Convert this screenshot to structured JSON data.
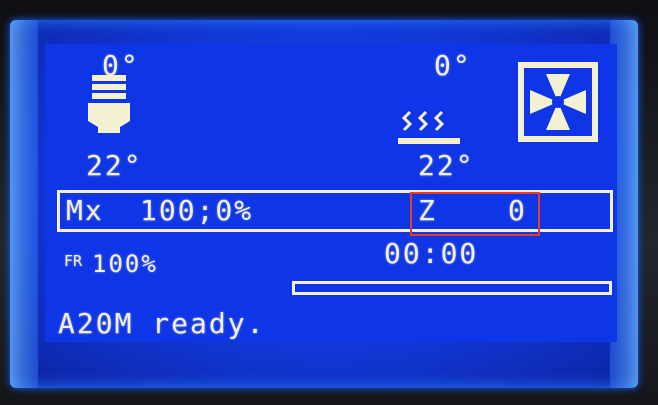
{
  "display": {
    "hotend": {
      "target": "0°",
      "current": "22°"
    },
    "bed": {
      "target": "0°",
      "current": "22°"
    },
    "position_line": {
      "axis_mode": "Mx",
      "x_value": "100;0%",
      "z_label": "Z",
      "z_value": "0"
    },
    "feedrate": {
      "label": "FR",
      "value": "100%"
    },
    "elapsed_time": "00:00",
    "progress_fraction": 0,
    "status_message": "A20M ready."
  },
  "colors": {
    "lcd_background": "#0f36e6",
    "lcd_text": "#f4f1d2",
    "highlight_box": "#e83a2e"
  }
}
